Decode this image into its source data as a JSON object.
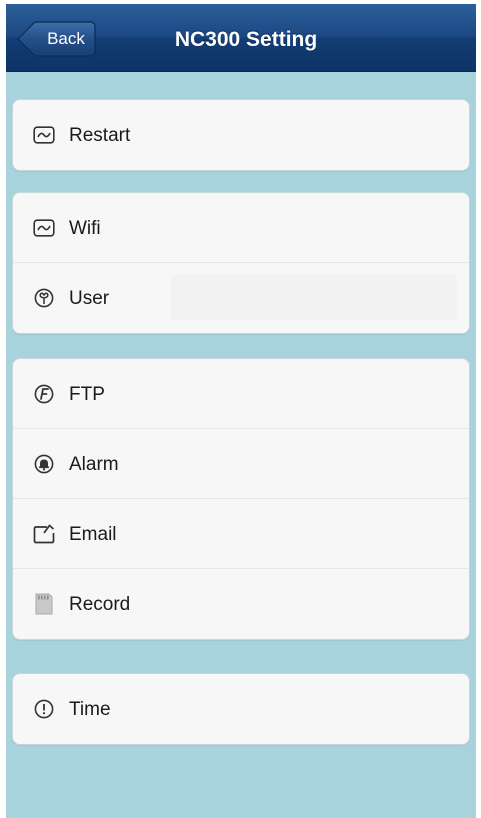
{
  "navbar": {
    "back_label": "Back",
    "title": "NC300  Setting",
    "color": "#1b4883"
  },
  "groups": [
    {
      "items": [
        {
          "label": "Restart",
          "icon": "monitor-icon"
        }
      ]
    },
    {
      "items": [
        {
          "label": "Wifi",
          "icon": "monitor-icon"
        },
        {
          "label": "User",
          "icon": "user-icon"
        }
      ]
    },
    {
      "items": [
        {
          "label": "FTP",
          "icon": "ftp-icon"
        },
        {
          "label": "Alarm",
          "icon": "alarm-bell-icon"
        },
        {
          "label": "Email",
          "icon": "email-icon"
        },
        {
          "label": "Record",
          "icon": "sd-card-icon"
        }
      ]
    },
    {
      "items": [
        {
          "label": "Time",
          "icon": "time-icon"
        }
      ]
    }
  ],
  "colors": {
    "background": "#a8d3dc",
    "group_bg": "#f7f7f7",
    "text": "#1a1a1a"
  }
}
